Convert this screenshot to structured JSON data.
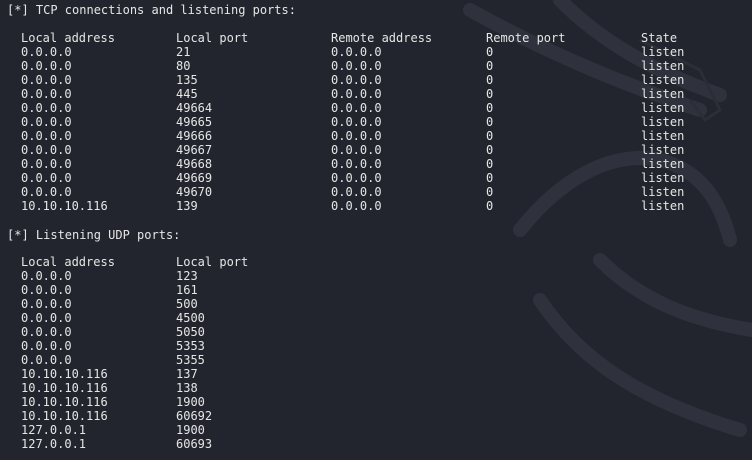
{
  "tcp": {
    "header": "[*] TCP connections and listening ports:",
    "columns": [
      "Local address",
      "Local port",
      "Remote address",
      "Remote port",
      "State"
    ],
    "rows": [
      [
        "0.0.0.0",
        "21",
        "0.0.0.0",
        "0",
        "listen"
      ],
      [
        "0.0.0.0",
        "80",
        "0.0.0.0",
        "0",
        "listen"
      ],
      [
        "0.0.0.0",
        "135",
        "0.0.0.0",
        "0",
        "listen"
      ],
      [
        "0.0.0.0",
        "445",
        "0.0.0.0",
        "0",
        "listen"
      ],
      [
        "0.0.0.0",
        "49664",
        "0.0.0.0",
        "0",
        "listen"
      ],
      [
        "0.0.0.0",
        "49665",
        "0.0.0.0",
        "0",
        "listen"
      ],
      [
        "0.0.0.0",
        "49666",
        "0.0.0.0",
        "0",
        "listen"
      ],
      [
        "0.0.0.0",
        "49667",
        "0.0.0.0",
        "0",
        "listen"
      ],
      [
        "0.0.0.0",
        "49668",
        "0.0.0.0",
        "0",
        "listen"
      ],
      [
        "0.0.0.0",
        "49669",
        "0.0.0.0",
        "0",
        "listen"
      ],
      [
        "0.0.0.0",
        "49670",
        "0.0.0.0",
        "0",
        "listen"
      ],
      [
        "10.10.10.116",
        "139",
        "0.0.0.0",
        "0",
        "listen"
      ]
    ]
  },
  "udp": {
    "header": "[*] Listening UDP ports:",
    "columns": [
      "Local address",
      "Local port"
    ],
    "rows": [
      [
        "0.0.0.0",
        "123"
      ],
      [
        "0.0.0.0",
        "161"
      ],
      [
        "0.0.0.0",
        "500"
      ],
      [
        "0.0.0.0",
        "4500"
      ],
      [
        "0.0.0.0",
        "5050"
      ],
      [
        "0.0.0.0",
        "5353"
      ],
      [
        "0.0.0.0",
        "5355"
      ],
      [
        "10.10.10.116",
        "137"
      ],
      [
        "10.10.10.116",
        "138"
      ],
      [
        "10.10.10.116",
        "1900"
      ],
      [
        "10.10.10.116",
        "60692"
      ],
      [
        "127.0.0.1",
        "1900"
      ],
      [
        "127.0.0.1",
        "60693"
      ]
    ]
  },
  "theme": {
    "background": "#23252e",
    "text": "#e6e6e6",
    "watermark": "#2e3039"
  },
  "icons": {
    "background": "kali-dragon-watermark-icon"
  }
}
